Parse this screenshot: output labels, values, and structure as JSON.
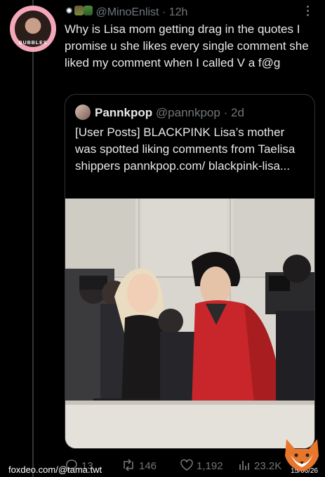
{
  "tweet": {
    "handle": "@MinoEnlist",
    "sep": "·",
    "time": "12h",
    "text": "Why is Lisa mom getting drag in the quotes I promise u she likes every single comment she liked my comment when I called V a f@g",
    "avatar_ring": "BUBBLES"
  },
  "quote": {
    "name": "Pannkpop",
    "handle": "@pannkpop",
    "sep": "·",
    "time": "2d",
    "text": "[User Posts] BLACKPINK Lisa’s mother was spotted liking comments from Taelisa shippers pannkpop.com/ blackpink-lisa..."
  },
  "actions": {
    "replies": "13",
    "reposts": "146",
    "likes": "1,192",
    "views": "23.2K"
  },
  "watermark": {
    "text": "foxdeo.com/@tama.twt",
    "date": "15/06/26"
  },
  "colors": {
    "background": "#000000",
    "text": "#e7e9ea",
    "muted": "#71767b",
    "border": "#2f3336",
    "avatar_ring": "#f3a7b8",
    "jacket": "#c8262a"
  },
  "icons": [
    "more-icon",
    "reply-icon",
    "repost-icon",
    "like-icon",
    "views-icon",
    "fox-logo"
  ]
}
